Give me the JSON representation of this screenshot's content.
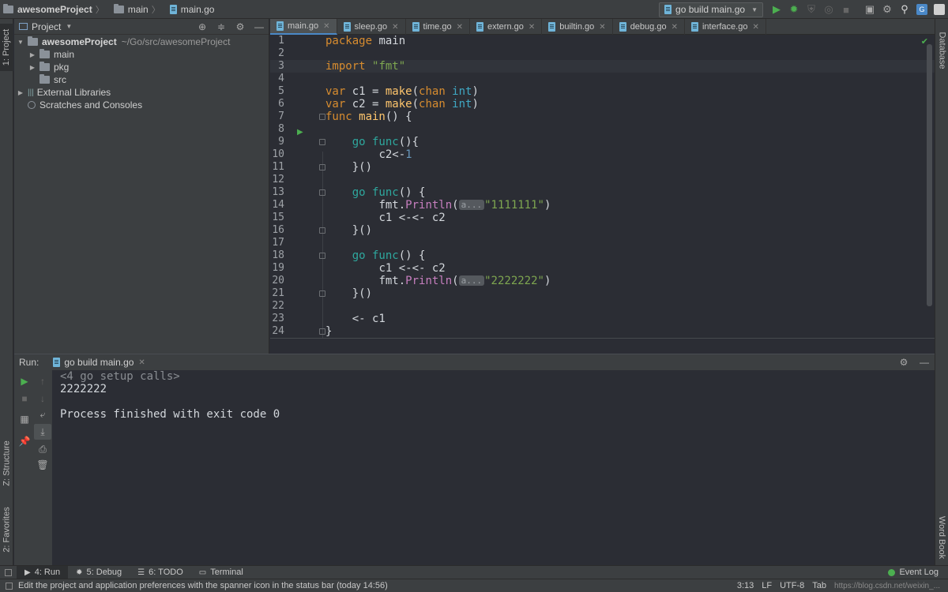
{
  "navbar": {
    "crumbs": [
      "awesomeProject",
      "main",
      "main.go"
    ],
    "run_config": "go build main.go"
  },
  "left_strip": {
    "project_tab": "1: Project",
    "structure_tab": "Z: Structure",
    "favorites_tab": "2: Favorites"
  },
  "right_strip": {
    "database_tab": "Database",
    "wordbook_tab": "Word Book"
  },
  "project": {
    "header": "Project",
    "tree": [
      {
        "label": "awesomeProject",
        "path": "~/Go/src/awesomeProject"
      },
      {
        "label": "main"
      },
      {
        "label": "pkg"
      },
      {
        "label": "src"
      },
      {
        "label": "External Libraries"
      },
      {
        "label": "Scratches and Consoles"
      }
    ]
  },
  "editor": {
    "tabs": [
      "main.go",
      "sleep.go",
      "time.go",
      "extern.go",
      "builtin.go",
      "debug.go",
      "interface.go"
    ],
    "line_numbers": [
      "1",
      "2",
      "3",
      "4",
      "5",
      "6",
      "7",
      "8",
      "9",
      "10",
      "11",
      "12",
      "13",
      "14",
      "15",
      "16",
      "17",
      "18",
      "19",
      "20",
      "21",
      "22",
      "23",
      "24"
    ],
    "code": {
      "l1_kw": "package",
      "l1_rest": " main",
      "l3_kw": "import",
      "l3_str": "\"fmt\"",
      "l5_kw": "var",
      "l5_a": " c1 = ",
      "l5_fn": "make",
      "l5_b": "(",
      "l5_kw2": "chan",
      "l5_ty": " int",
      "l5_c": ")",
      "l6_kw": "var",
      "l6_a": " c2 = ",
      "l6_fn": "make",
      "l6_b": "(",
      "l6_kw2": "chan",
      "l6_ty": " int",
      "l6_c": ")",
      "l7_kw": "func",
      "l7_fn": " main",
      "l7_rest": "() {",
      "l9_kw": "go",
      "l9_kw2": " func",
      "l9_rest": "(){",
      "l10_a": "c2<-",
      "l10_num": "1",
      "l11": "}()",
      "l13_kw": "go",
      "l13_kw2": " func",
      "l13_rest": "() {",
      "l14_a": "fmt.",
      "l14_fn": "Println",
      "l14_b": "(",
      "l14_hint": "a...",
      "l14_str": "\"1111111\"",
      "l14_c": ")",
      "l15": "c1 <-<- c2",
      "l16": "}()",
      "l18_kw": "go",
      "l18_kw2": " func",
      "l18_rest": "() {",
      "l19": "c1 <-<- c2",
      "l20_a": "fmt.",
      "l20_fn": "Println",
      "l20_b": "(",
      "l20_hint": "a...",
      "l20_str": "\"2222222\"",
      "l20_c": ")",
      "l21": "}()",
      "l23": "<- c1",
      "l24": "}"
    }
  },
  "run": {
    "label": "Run:",
    "tab": "go build main.go",
    "console": [
      "<4 go setup calls>",
      "2222222",
      "",
      "Process finished with exit code 0"
    ]
  },
  "bottom_tabs": [
    "4: Run",
    "5: Debug",
    "6: TODO",
    "Terminal"
  ],
  "event_log": "Event Log",
  "status": {
    "message": "Edit the project and application preferences with the spanner icon in the status bar (today 14:56)",
    "position": "3:13",
    "line_sep": "LF",
    "encoding": "UTF-8",
    "indent": "Tab",
    "watermark": "https://blog.csdn.net/weixin_..."
  }
}
